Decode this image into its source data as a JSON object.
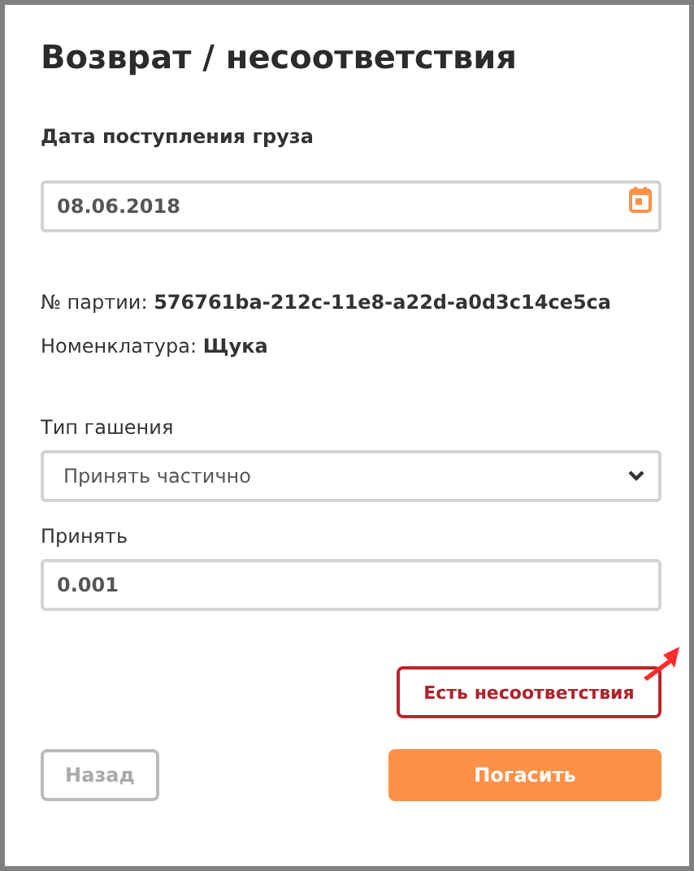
{
  "title": "Возврат / несоответствия",
  "date_field": {
    "label": "Дата поступления груза",
    "value": "08.06.2018"
  },
  "info": [
    {
      "label": "№ партии:",
      "value": "576761ba-212c-11e8-a22d-a0d3c14ce5ca"
    },
    {
      "label": "Номенклатура:",
      "value": "Щука"
    }
  ],
  "redemption_type": {
    "label": "Тип гашения",
    "value": "Принять частично"
  },
  "accept": {
    "label": "Принять",
    "value": "0.001"
  },
  "mismatch_button": {
    "label": "Есть несоответствия"
  },
  "buttons": [
    {
      "kind": "back",
      "label": "Назад",
      "disabled": true
    },
    {
      "kind": "submit",
      "label": "Погасить",
      "disabled": false
    }
  ]
}
